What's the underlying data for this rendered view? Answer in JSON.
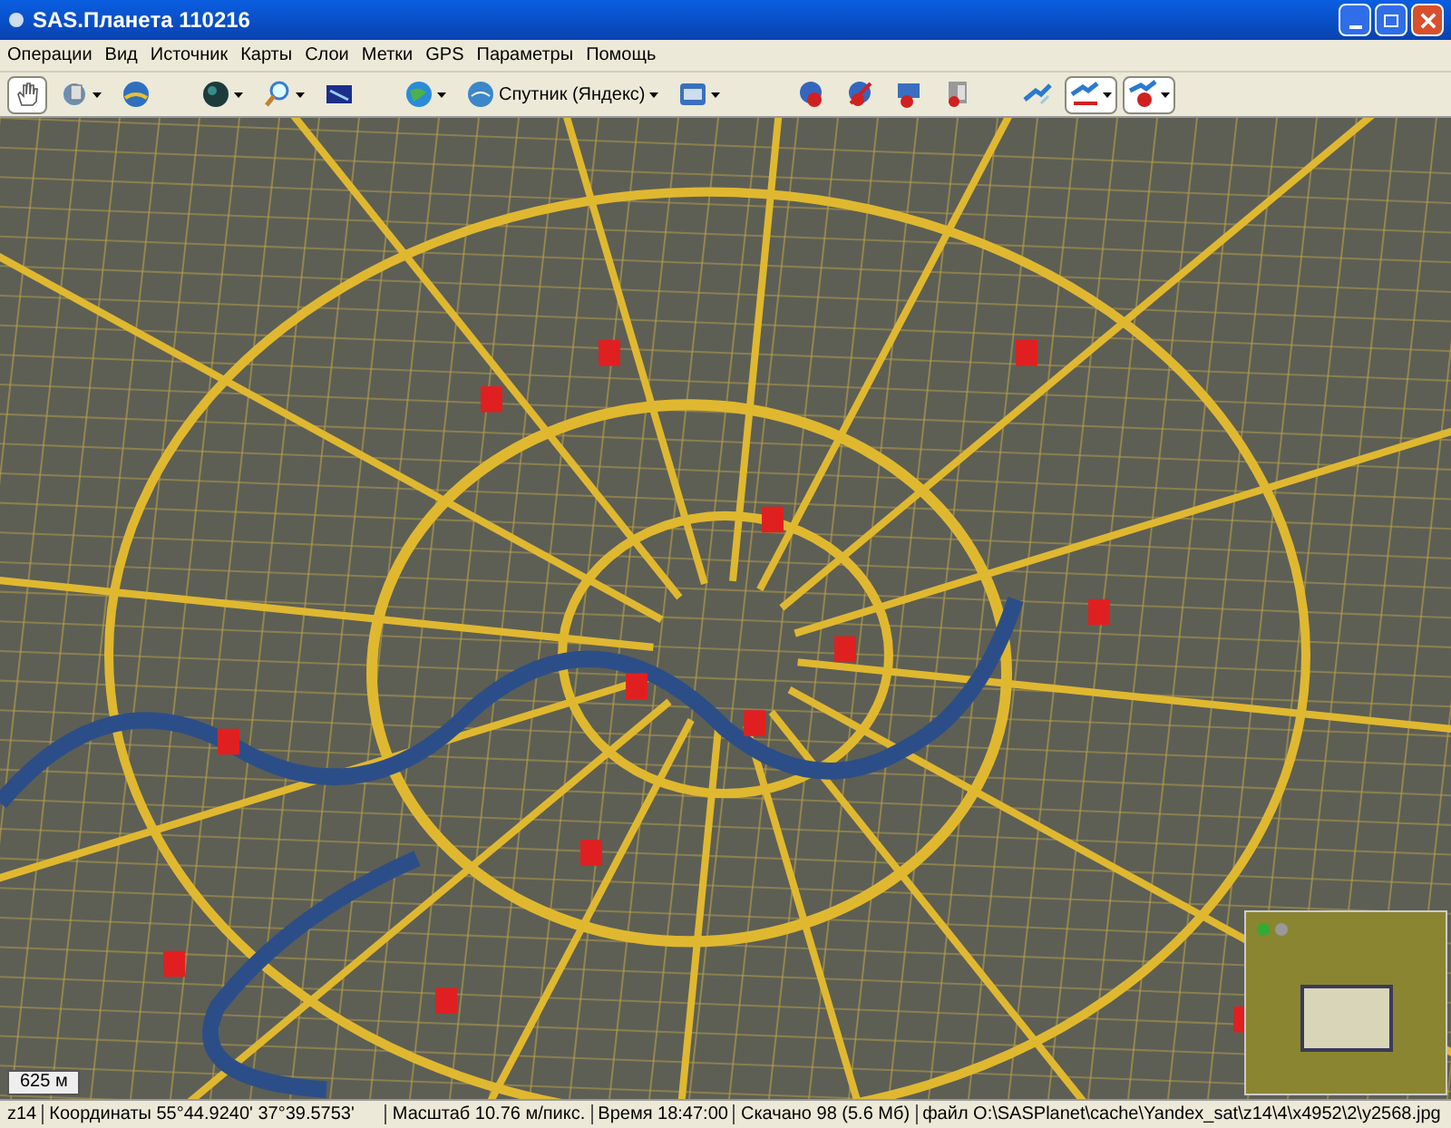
{
  "window": {
    "title": "SAS.Планета 110216"
  },
  "menu": [
    "Операции",
    "Вид",
    "Источник",
    "Карты",
    "Слои",
    "Метки",
    "GPS",
    "Параметры",
    "Помощь"
  ],
  "toolbar": [
    {
      "selected": true,
      "dropdown": false
    },
    {
      "selected": false,
      "dropdown": true
    },
    {
      "selected": false,
      "dropdown": false
    },
    {
      "selected": false,
      "dropdown": true
    },
    {
      "selected": false,
      "dropdown": true
    },
    {
      "selected": false,
      "dropdown": false
    },
    {
      "selected": false,
      "dropdown": true
    },
    {
      "selected": false,
      "dropdown": true,
      "label": "Спутник (Яндекс)"
    },
    {
      "selected": false,
      "dropdown": true
    },
    {
      "selected": false,
      "dropdown": false
    },
    {
      "selected": false,
      "dropdown": false
    },
    {
      "selected": false,
      "dropdown": false
    },
    {
      "selected": false,
      "dropdown": false
    },
    {
      "selected": false,
      "dropdown": false
    },
    {
      "selected": true,
      "dropdown": true
    },
    {
      "selected": true,
      "dropdown": true
    }
  ],
  "map": {
    "scale_label": "625 м"
  },
  "status_bar": [
    "z14",
    "Координаты 55°44.9240' 37°39.5753'",
    "Масштаб 10.76 м/пикс.",
    "Время 18:47:00",
    "Скачано 98 (5.6 Мб)",
    "файл O:\\SASPlanet\\cache\\Yandex_sat\\z14\\4\\x4952\\2\\y2568.jpg"
  ]
}
